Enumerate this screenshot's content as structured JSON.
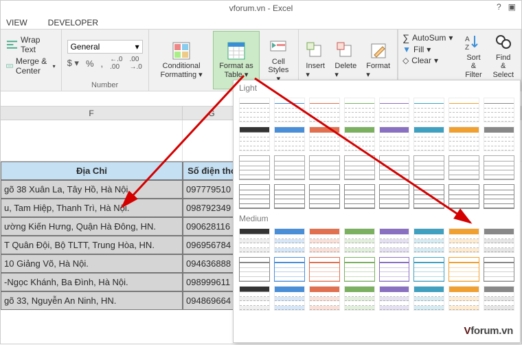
{
  "title": "vforum.vn - Excel",
  "tabs": {
    "view": "VIEW",
    "developer": "DEVELOPER"
  },
  "ribbon": {
    "wrap": "Wrap Text",
    "merge": "Merge & Center",
    "number_format": "General",
    "number_label": "Number",
    "cond_fmt": "Conditional Formatting",
    "fmt_table": "Format as Table",
    "cell_styles": "Cell Styles",
    "insert": "Insert",
    "delete": "Delete",
    "format": "Format",
    "autosum": "AutoSum",
    "fill": "Fill",
    "clear": "Clear",
    "sort": "Sort & Filter",
    "find": "Find & Select"
  },
  "columns": {
    "F": "F",
    "G": "G"
  },
  "table": {
    "header": {
      "addr": "Địa Chỉ",
      "phone": "Số điện tho"
    },
    "rows": [
      {
        "addr": "gõ 38 Xuân La, Tây Hồ, Hà Nội.",
        "phone": "097779510"
      },
      {
        "addr": "u, Tam Hiệp, Thanh Trì, Hà Nội.",
        "phone": "098792349"
      },
      {
        "addr": "ường Kiến Hưng, Quận Hà Đông, HN.",
        "phone": "090628116"
      },
      {
        "addr": "T Quân Đội, Bộ TLTT, Trung Hòa, HN.",
        "phone": "096956784"
      },
      {
        "addr": " 10 Giảng Võ, Hà Nội.",
        "phone": "094636888"
      },
      {
        "addr": "-Ngọc Khánh, Ba Đình, Hà Nội.",
        "phone": "098999611"
      },
      {
        "addr": "gõ 33, Nguyễn An Ninh, HN.",
        "phone": "094869664"
      }
    ]
  },
  "gallery": {
    "light": "Light",
    "medium": "Medium"
  },
  "watermark": {
    "a": "V",
    "b": "forum.vn"
  }
}
